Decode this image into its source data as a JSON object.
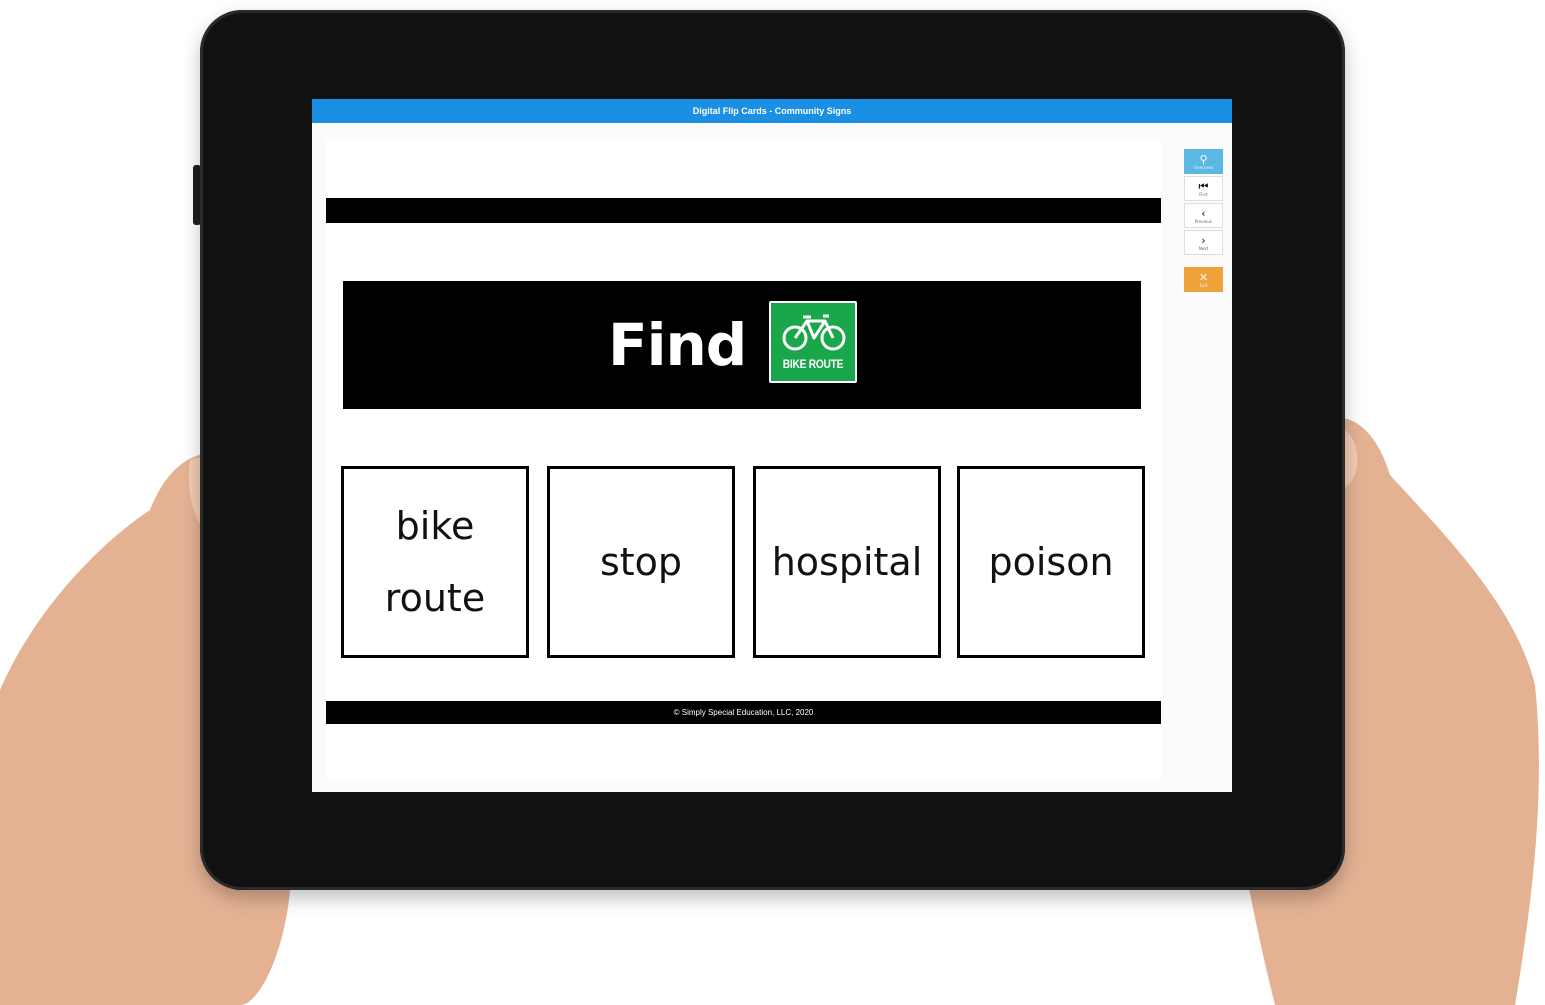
{
  "app": {
    "title": "Digital Flip Cards - Community Signs"
  },
  "prompt": {
    "word": "Find",
    "sign": {
      "icon": "bicycle-icon",
      "label": "BIKE ROUTE",
      "color": "#1aa64a"
    }
  },
  "choices": [
    {
      "lines": [
        "bike",
        "route"
      ]
    },
    {
      "lines": [
        "stop"
      ]
    },
    {
      "lines": [
        "hospital"
      ]
    },
    {
      "lines": [
        "poison"
      ]
    }
  ],
  "footer": {
    "copyright": "© Simply Special Education, LLC, 2020"
  },
  "toolbar": {
    "overview": {
      "icon": "search-icon",
      "label": "Overview"
    },
    "first": {
      "icon": "first-icon",
      "label": "First"
    },
    "previous": {
      "icon": "previous-icon",
      "label": "Previous"
    },
    "next": {
      "icon": "next-icon",
      "label": "Next"
    },
    "exit": {
      "icon": "close-icon",
      "label": "Exit"
    }
  },
  "colors": {
    "titlebar": "#1a8fe3",
    "overview_button": "#5ab8e3",
    "exit_button": "#f0a23a"
  }
}
